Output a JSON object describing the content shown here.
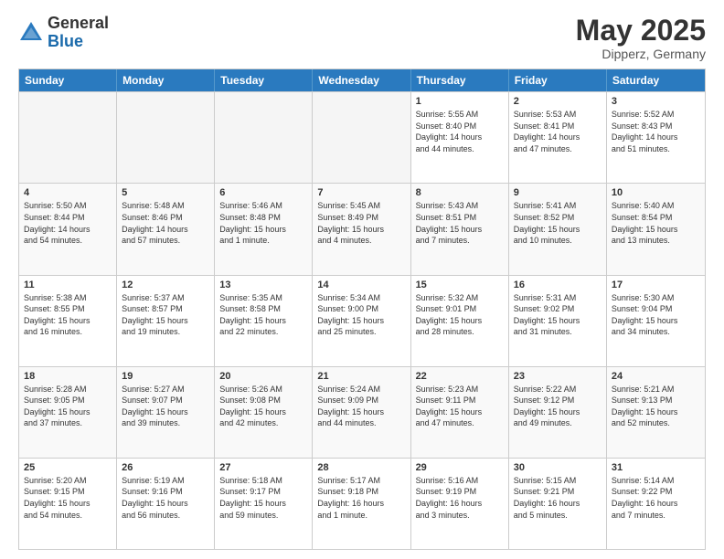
{
  "logo": {
    "general": "General",
    "blue": "Blue"
  },
  "title": {
    "month_year": "May 2025",
    "location": "Dipperz, Germany"
  },
  "weekdays": [
    "Sunday",
    "Monday",
    "Tuesday",
    "Wednesday",
    "Thursday",
    "Friday",
    "Saturday"
  ],
  "rows": [
    [
      {
        "day": "",
        "info": ""
      },
      {
        "day": "",
        "info": ""
      },
      {
        "day": "",
        "info": ""
      },
      {
        "day": "",
        "info": ""
      },
      {
        "day": "1",
        "info": "Sunrise: 5:55 AM\nSunset: 8:40 PM\nDaylight: 14 hours\nand 44 minutes."
      },
      {
        "day": "2",
        "info": "Sunrise: 5:53 AM\nSunset: 8:41 PM\nDaylight: 14 hours\nand 47 minutes."
      },
      {
        "day": "3",
        "info": "Sunrise: 5:52 AM\nSunset: 8:43 PM\nDaylight: 14 hours\nand 51 minutes."
      }
    ],
    [
      {
        "day": "4",
        "info": "Sunrise: 5:50 AM\nSunset: 8:44 PM\nDaylight: 14 hours\nand 54 minutes."
      },
      {
        "day": "5",
        "info": "Sunrise: 5:48 AM\nSunset: 8:46 PM\nDaylight: 14 hours\nand 57 minutes."
      },
      {
        "day": "6",
        "info": "Sunrise: 5:46 AM\nSunset: 8:48 PM\nDaylight: 15 hours\nand 1 minute."
      },
      {
        "day": "7",
        "info": "Sunrise: 5:45 AM\nSunset: 8:49 PM\nDaylight: 15 hours\nand 4 minutes."
      },
      {
        "day": "8",
        "info": "Sunrise: 5:43 AM\nSunset: 8:51 PM\nDaylight: 15 hours\nand 7 minutes."
      },
      {
        "day": "9",
        "info": "Sunrise: 5:41 AM\nSunset: 8:52 PM\nDaylight: 15 hours\nand 10 minutes."
      },
      {
        "day": "10",
        "info": "Sunrise: 5:40 AM\nSunset: 8:54 PM\nDaylight: 15 hours\nand 13 minutes."
      }
    ],
    [
      {
        "day": "11",
        "info": "Sunrise: 5:38 AM\nSunset: 8:55 PM\nDaylight: 15 hours\nand 16 minutes."
      },
      {
        "day": "12",
        "info": "Sunrise: 5:37 AM\nSunset: 8:57 PM\nDaylight: 15 hours\nand 19 minutes."
      },
      {
        "day": "13",
        "info": "Sunrise: 5:35 AM\nSunset: 8:58 PM\nDaylight: 15 hours\nand 22 minutes."
      },
      {
        "day": "14",
        "info": "Sunrise: 5:34 AM\nSunset: 9:00 PM\nDaylight: 15 hours\nand 25 minutes."
      },
      {
        "day": "15",
        "info": "Sunrise: 5:32 AM\nSunset: 9:01 PM\nDaylight: 15 hours\nand 28 minutes."
      },
      {
        "day": "16",
        "info": "Sunrise: 5:31 AM\nSunset: 9:02 PM\nDaylight: 15 hours\nand 31 minutes."
      },
      {
        "day": "17",
        "info": "Sunrise: 5:30 AM\nSunset: 9:04 PM\nDaylight: 15 hours\nand 34 minutes."
      }
    ],
    [
      {
        "day": "18",
        "info": "Sunrise: 5:28 AM\nSunset: 9:05 PM\nDaylight: 15 hours\nand 37 minutes."
      },
      {
        "day": "19",
        "info": "Sunrise: 5:27 AM\nSunset: 9:07 PM\nDaylight: 15 hours\nand 39 minutes."
      },
      {
        "day": "20",
        "info": "Sunrise: 5:26 AM\nSunset: 9:08 PM\nDaylight: 15 hours\nand 42 minutes."
      },
      {
        "day": "21",
        "info": "Sunrise: 5:24 AM\nSunset: 9:09 PM\nDaylight: 15 hours\nand 44 minutes."
      },
      {
        "day": "22",
        "info": "Sunrise: 5:23 AM\nSunset: 9:11 PM\nDaylight: 15 hours\nand 47 minutes."
      },
      {
        "day": "23",
        "info": "Sunrise: 5:22 AM\nSunset: 9:12 PM\nDaylight: 15 hours\nand 49 minutes."
      },
      {
        "day": "24",
        "info": "Sunrise: 5:21 AM\nSunset: 9:13 PM\nDaylight: 15 hours\nand 52 minutes."
      }
    ],
    [
      {
        "day": "25",
        "info": "Sunrise: 5:20 AM\nSunset: 9:15 PM\nDaylight: 15 hours\nand 54 minutes."
      },
      {
        "day": "26",
        "info": "Sunrise: 5:19 AM\nSunset: 9:16 PM\nDaylight: 15 hours\nand 56 minutes."
      },
      {
        "day": "27",
        "info": "Sunrise: 5:18 AM\nSunset: 9:17 PM\nDaylight: 15 hours\nand 59 minutes."
      },
      {
        "day": "28",
        "info": "Sunrise: 5:17 AM\nSunset: 9:18 PM\nDaylight: 16 hours\nand 1 minute."
      },
      {
        "day": "29",
        "info": "Sunrise: 5:16 AM\nSunset: 9:19 PM\nDaylight: 16 hours\nand 3 minutes."
      },
      {
        "day": "30",
        "info": "Sunrise: 5:15 AM\nSunset: 9:21 PM\nDaylight: 16 hours\nand 5 minutes."
      },
      {
        "day": "31",
        "info": "Sunrise: 5:14 AM\nSunset: 9:22 PM\nDaylight: 16 hours\nand 7 minutes."
      }
    ]
  ]
}
